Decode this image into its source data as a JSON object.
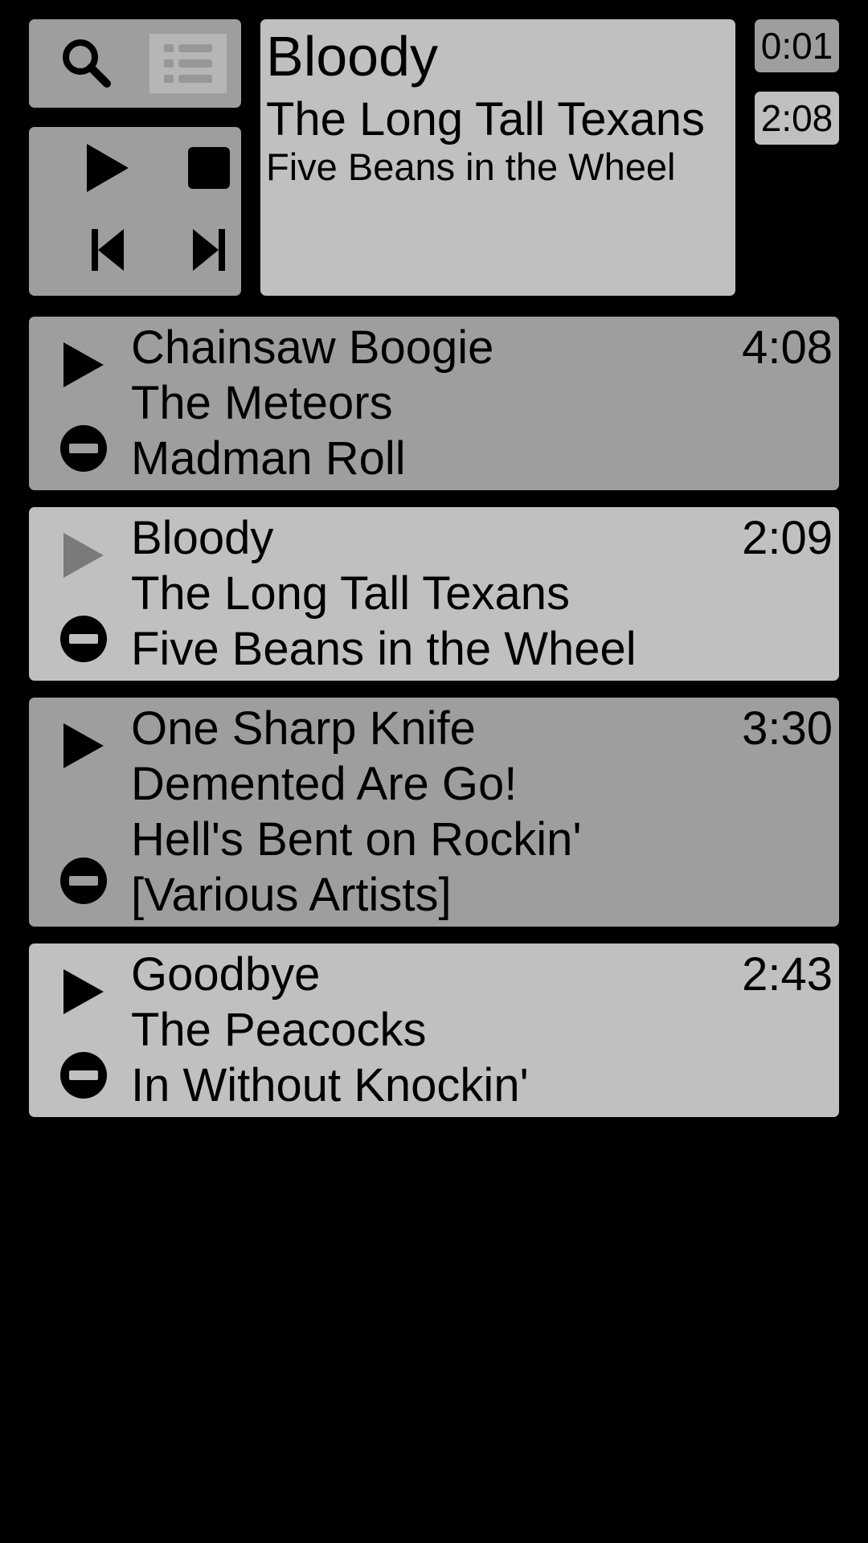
{
  "toolbar": {
    "search_icon": "search-icon",
    "list_icon": "playlist-icon"
  },
  "transport": {
    "play_icon": "play-icon",
    "stop_icon": "stop-icon",
    "previous_icon": "skip-previous-icon",
    "next_icon": "skip-next-icon"
  },
  "now_playing": {
    "title": "Bloody",
    "artist": "The Long Tall Texans",
    "album": "Five Beans in the Wheel",
    "elapsed": "0:01",
    "total": "2:08"
  },
  "playlist": [
    {
      "title": "Chainsaw Boogie",
      "artist": "The Meteors",
      "album": "Madman Roll",
      "extra": "",
      "duration": "4:08",
      "current": false
    },
    {
      "title": "Bloody",
      "artist": "The Long Tall Texans",
      "album": "Five Beans in the Wheel",
      "extra": "",
      "duration": "2:09",
      "current": true
    },
    {
      "title": "One Sharp Knife",
      "artist": "Demented Are Go!",
      "album": "Hell's Bent on Rockin'",
      "extra": "[Various Artists]",
      "duration": "3:30",
      "current": false
    },
    {
      "title": "Goodbye",
      "artist": "The Peacocks",
      "album": "In Without Knockin'",
      "extra": "",
      "duration": "2:43",
      "current": false
    }
  ],
  "colors": {
    "background": "#000000",
    "panel_dark": "#9e9e9e",
    "panel_light": "#c0c0c0",
    "disabled_icon": "#7a7a7a"
  }
}
